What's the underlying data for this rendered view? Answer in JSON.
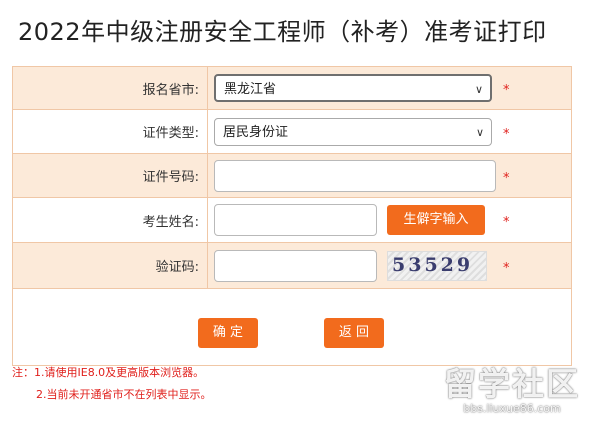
{
  "page": {
    "title": "2022年中级注册安全工程师（补考）准考证打印"
  },
  "form": {
    "province_label": "报名省市:",
    "province_value": "黑龙江省",
    "id_type_label": "证件类型:",
    "id_type_value": "居民身份证",
    "id_number_label": "证件号码:",
    "id_number_value": "",
    "name_label": "考生姓名:",
    "name_value": "",
    "rare_char_button": "生僻字输入",
    "captcha_label": "验证码:",
    "captcha_value": "",
    "captcha_image_text": "53529",
    "required_mark": "*"
  },
  "actions": {
    "confirm": "确 定",
    "back": "返 回"
  },
  "notes": {
    "line1": "注：1.请使用IE8.0及更高版本浏览器。",
    "line2": "2.当前未开通省市不在列表中显示。"
  },
  "watermark": {
    "main": "留学社区",
    "url": "bbs.liuxue86.com"
  },
  "colors": {
    "accent_orange": "#f26b1d",
    "row_shade": "#fcead9",
    "border": "#f0c7a6",
    "required_red": "#e0201c"
  },
  "icons": {
    "dropdown": "chevron-down-icon"
  }
}
